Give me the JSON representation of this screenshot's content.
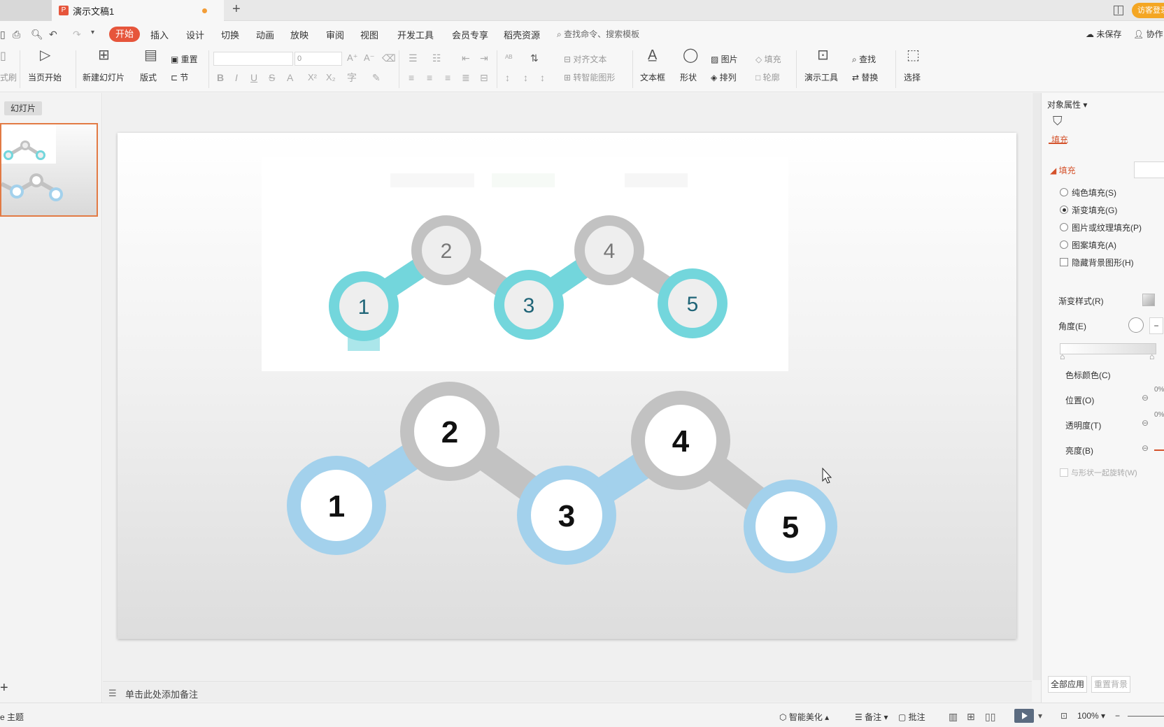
{
  "titlebar": {
    "doc_title": "演示文稿1",
    "doc_icon": "P",
    "add_tab": "+",
    "login_label": "访客登录"
  },
  "menu": {
    "items": [
      "开始",
      "插入",
      "设计",
      "切换",
      "动画",
      "放映",
      "审阅",
      "视图",
      "开发工具",
      "会员专享",
      "稻壳资源"
    ],
    "search_placeholder": "查找命令、搜索模板",
    "unsaved": "未保存",
    "collab": "协作"
  },
  "ribbon": {
    "format_painter": "式刷",
    "from_current": "当页开始",
    "new_slide": "新建幻灯片",
    "layout": "版式",
    "reset": "重置",
    "section": "节",
    "font_size": "0",
    "align_text": "对齐文本",
    "to_smartart": "转智能图形",
    "textbox": "文本框",
    "shape": "形状",
    "picture": "图片",
    "fill": "填充",
    "arrange": "排列",
    "outline": "轮廓",
    "present_tools": "演示工具",
    "find": "查找",
    "replace": "替换",
    "select": "选择"
  },
  "left_panel": {
    "tab": "幻灯片",
    "add": "+"
  },
  "slide": {
    "top_labels": [
      "1",
      "2",
      "3",
      "4",
      "5"
    ],
    "bottom_labels": [
      "1",
      "2",
      "3",
      "4",
      "5"
    ],
    "accent_teal": "#73d6dc",
    "accent_blue": "#a3d1ec",
    "gray": "#c2c2c2"
  },
  "notes": {
    "placeholder": "单击此处添加备注"
  },
  "right_panel": {
    "title": "对象属性",
    "fill_tab": "填充",
    "section": "填充",
    "options": [
      "纯色填充(S)",
      "渐变填充(G)",
      "图片或纹理填充(P)",
      "图案填充(A)"
    ],
    "hide_bg": "隐藏背景图形(H)",
    "gradient_style": "渐变样式(R)",
    "angle": "角度(E)",
    "stop_color": "色标颜色(C)",
    "position": "位置(O)",
    "transparency": "透明度(T)",
    "brightness": "亮度(B)",
    "rotate_with_shape": "与形状一起旋转(W)",
    "percent_pos": "0%",
    "percent_trans": "0%",
    "apply_all": "全部应用",
    "reset_bg": "重置背景"
  },
  "statusbar": {
    "theme": "主题",
    "beautify": "智能美化",
    "notes": "备注",
    "comments": "批注",
    "zoom": "100%"
  }
}
